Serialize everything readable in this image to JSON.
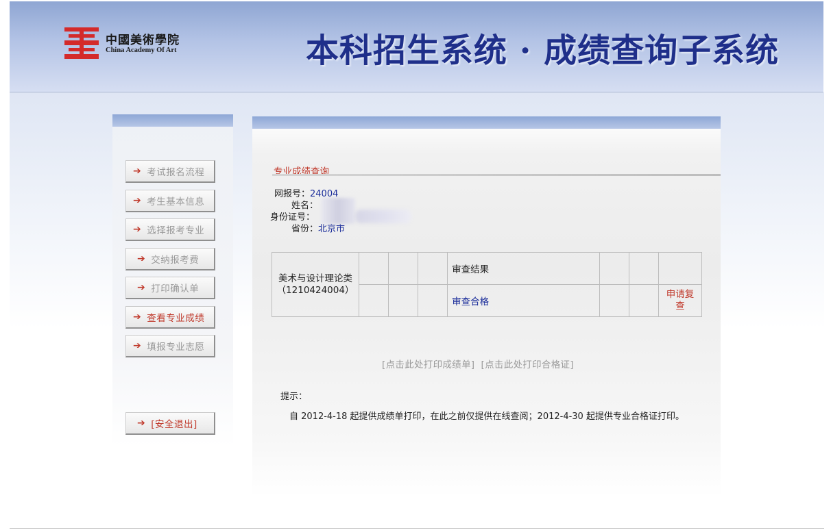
{
  "header": {
    "logo_cn": "中國美術學院",
    "logo_en": "China Academy Of Art",
    "system_title": "本科招生系统 · 成绩查询子系统"
  },
  "sidebar": {
    "items": [
      {
        "label": "考试报名流程",
        "arrow": "➔",
        "active": false
      },
      {
        "label": "考生基本信息",
        "arrow": "➔",
        "active": false
      },
      {
        "label": "选择报考专业",
        "arrow": "➔",
        "active": false
      },
      {
        "label": "交纳报考费",
        "arrow": "➔",
        "active": false
      },
      {
        "label": "打印确认单",
        "arrow": "➔",
        "active": false
      },
      {
        "label": "查看专业成绩",
        "arrow": "➔",
        "active": true
      },
      {
        "label": "填报专业志愿",
        "arrow": "➔",
        "active": false
      }
    ],
    "logout": {
      "label": "[安全退出]",
      "arrow": "➔"
    }
  },
  "main": {
    "section_title": "专业成绩查询",
    "info": {
      "reg_label": "网报号：",
      "reg_value": "24004",
      "name_label": "姓名：",
      "name_value": "",
      "id_label": "身份证号：",
      "id_value": "",
      "province_label": "省份：",
      "province_value": "北京市"
    },
    "table": {
      "subject": "美术与设计理论类",
      "subject_code": "（1210424004）",
      "review_header": "审查结果",
      "review_value": "审查合格",
      "apply_recheck": "申请复查"
    },
    "print_score_link": "[点击此处打印成绩单]",
    "print_cert_link": "[点击此处打印合格证]",
    "tip_label": "提示：",
    "tip_text": "自 2012-4-18 起提供成绩单打印，在此之前仅提供在线查阅；2012-4-30 起提供专业合格证打印。"
  },
  "colors": {
    "header_bg": "#a9bce3",
    "title_blue": "#1f2f8a",
    "accent_red": "#c0392b",
    "value_blue": "#1a2c9a",
    "logo_red": "#d42a2a"
  }
}
